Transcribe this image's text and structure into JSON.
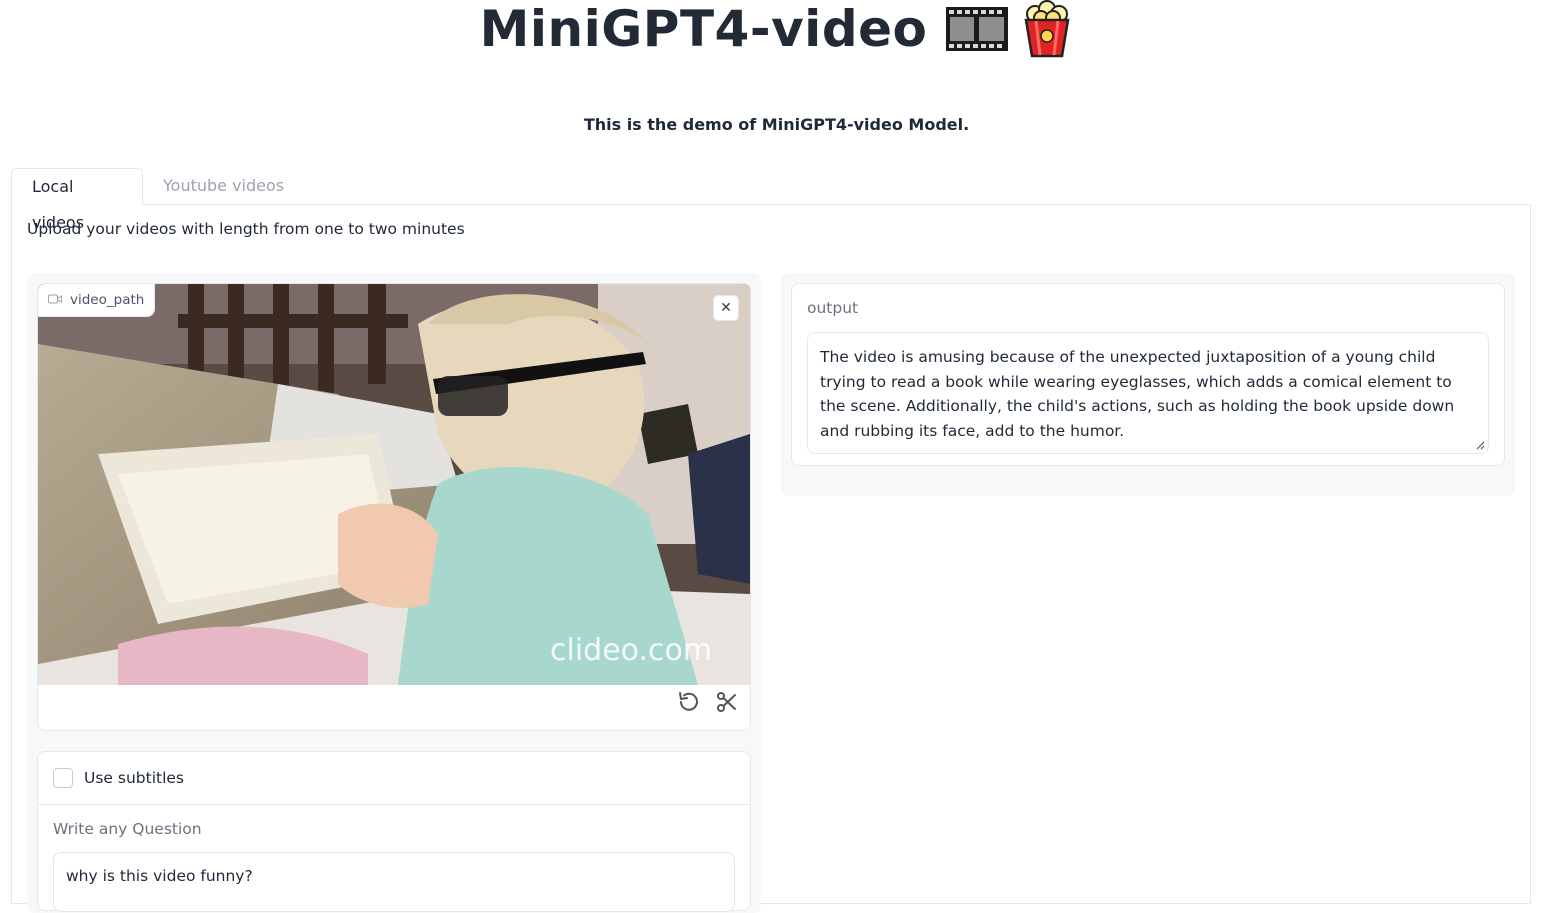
{
  "header": {
    "title": "MiniGPT4-video",
    "emojis": [
      "film-frames-icon",
      "popcorn-icon"
    ],
    "subtitle": "This is the demo of MiniGPT4-video Model."
  },
  "tabs": [
    {
      "label": "Local videos",
      "active": true
    },
    {
      "label": "Youtube videos",
      "active": false
    }
  ],
  "local": {
    "description": "Upload your videos with length from one to two minutes",
    "video": {
      "label": "video_path",
      "watermark": "clideo.com"
    },
    "subtitles": {
      "label": "Use subtitles",
      "checked": false
    },
    "question": {
      "label": "Write any Question",
      "value": "why is this video funny?"
    }
  },
  "output": {
    "label": "output",
    "text": "The video is amusing because of the unexpected juxtaposition of a young child trying to read a book while wearing eyeglasses, which adds a comical element to the scene. Additionally, the child's actions, such as holding the book upside down and rubbing its face, add to the humor."
  },
  "colors": {
    "title": "#222a36",
    "panel_bg": "#f7f8fa",
    "border": "#e5e7eb",
    "muted": "#6b7280"
  }
}
